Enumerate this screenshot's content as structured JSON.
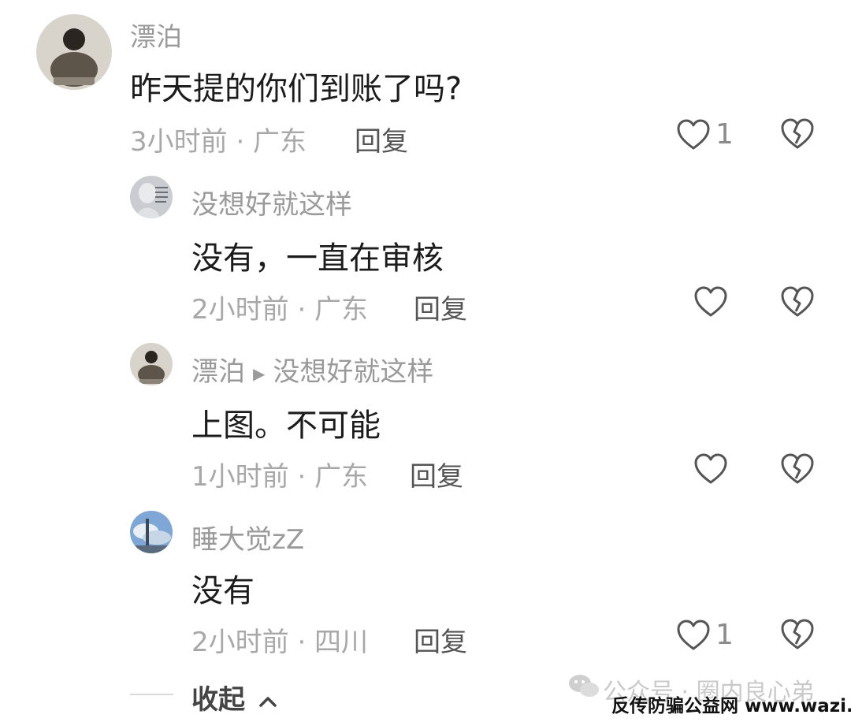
{
  "comments": [
    {
      "author": "漂泊",
      "text": "昨天提的你们到账了吗?",
      "meta": "3小时前 · 广东",
      "reply_label": "回复",
      "likes": "1",
      "avatar_icon": "avatar-boy-sitting"
    },
    {
      "author": "没想好就这样",
      "text": "没有，一直在审核",
      "meta": "2小时前 · 广东",
      "reply_label": "回复",
      "likes": "",
      "avatar_icon": "avatar-statue"
    },
    {
      "author": "漂泊",
      "reply_to": "没想好就这样",
      "text": "上图。不可能",
      "meta": "1小时前 · 广东",
      "reply_label": "回复",
      "likes": "",
      "avatar_icon": "avatar-boy-sitting"
    },
    {
      "author": "睡大觉zZ",
      "text": "没有",
      "meta": "2小时前 · 四川",
      "reply_label": "回复",
      "likes": "1",
      "avatar_icon": "avatar-sky"
    }
  ],
  "collapse_label": "收起",
  "watermark": {
    "gray": "公众号 · 圈内良心弟",
    "black": "反传防骗公益网 www.wazi.cc"
  },
  "colors": {
    "text": "#1c1c1c",
    "muted": "#a8a8a8",
    "icon": "#555555"
  }
}
